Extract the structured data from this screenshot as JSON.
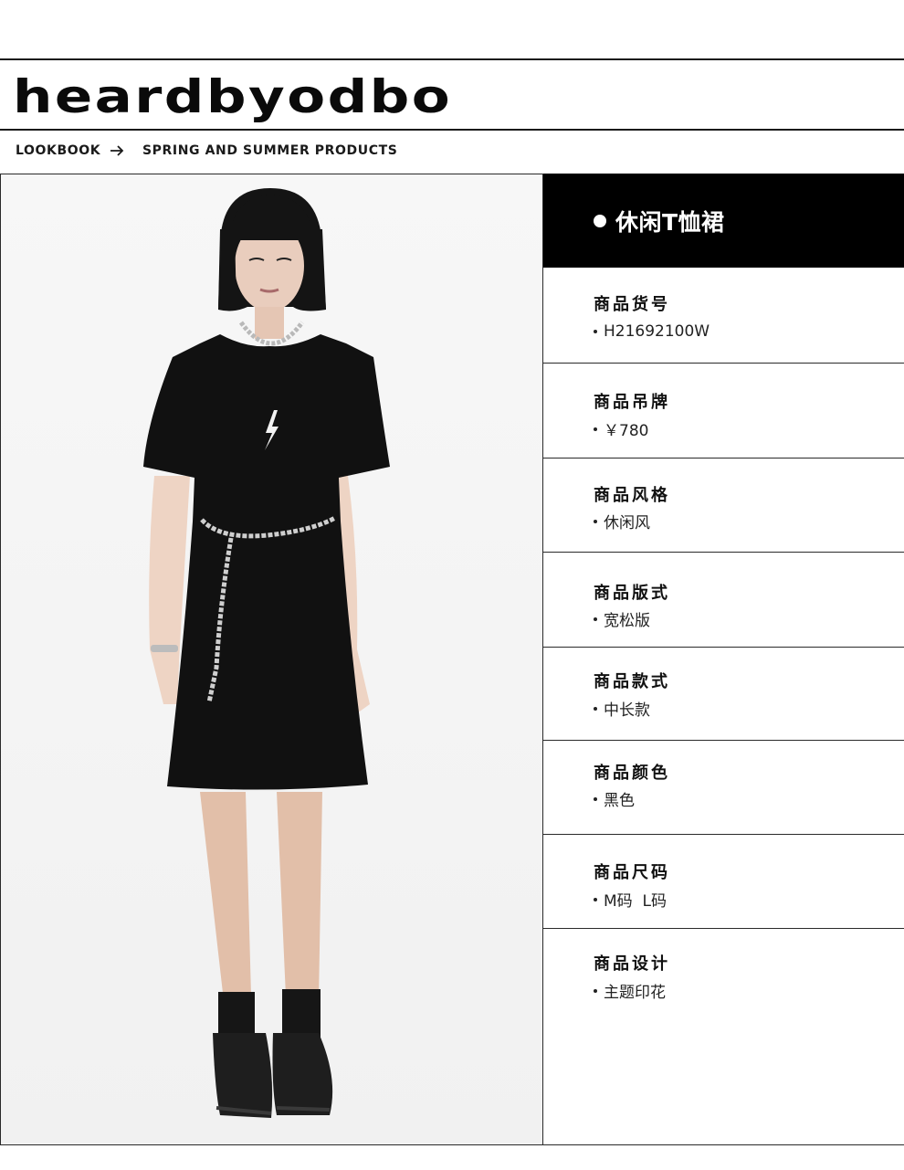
{
  "header": {
    "brand": "heardbyodbo",
    "breadcrumb": {
      "first": "LOOKBOOK",
      "second": "SPRING AND SUMMER PRODUCTS",
      "separator_icon": "arrow-right-icon"
    }
  },
  "product": {
    "title": "休闲T恤裙",
    "attributes": [
      {
        "label": "商品货号",
        "value": "H21692100W"
      },
      {
        "label": "商品吊牌",
        "value": "￥780"
      },
      {
        "label": "商品风格",
        "value": "休闲风"
      },
      {
        "label": "商品版式",
        "value": "宽松版"
      },
      {
        "label": "商品款式",
        "value": "中长款"
      },
      {
        "label": "商品颜色",
        "value": "黑色"
      },
      {
        "label": "商品尺码",
        "value": "M码  L码"
      },
      {
        "label": "商品设计",
        "value": "主题印花"
      }
    ]
  },
  "colors": {
    "title_bar": "#000000",
    "title_text": "#ffffff",
    "rule": "#1a1a1a",
    "photo_background": "#f4f4f4"
  }
}
